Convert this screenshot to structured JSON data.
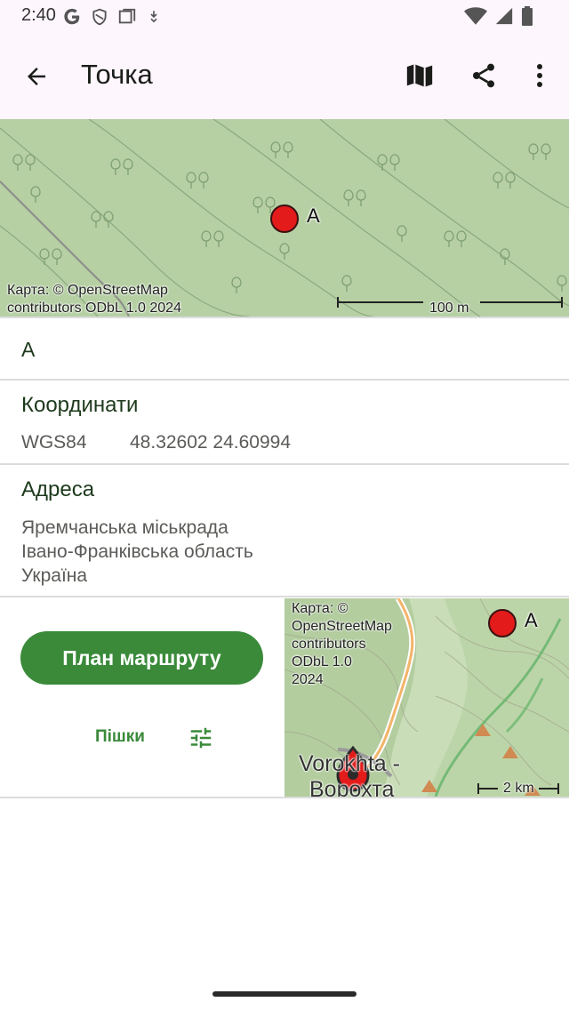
{
  "status": {
    "time": "2:40"
  },
  "appbar": {
    "title": "Точка"
  },
  "map_top": {
    "attribution_line1": "Карта: © OpenStreetMap",
    "attribution_line2": "contributors ODbL 1.0 2024",
    "scale": "100 m",
    "marker_label": "A"
  },
  "point": {
    "name": "A"
  },
  "coordinates": {
    "title": "Координати",
    "system": "WGS84",
    "value": "48.32602  24.60994"
  },
  "address": {
    "title": "Адреса",
    "lines": [
      "Яремчанська міськрада",
      "Івано-Франківська область",
      "Україна"
    ]
  },
  "route": {
    "button_label": "План маршруту",
    "mode": "Пішки"
  },
  "map_mini": {
    "attribution": [
      "Карта: ©",
      "OpenStreetMap",
      "contributors",
      "ODbL 1.0",
      "2024"
    ],
    "marker_label": "A",
    "place_label_1": "Vorokhta -",
    "place_label_2": "Ворохта",
    "scale": "2 km"
  },
  "colors": {
    "accent": "#3a8a3a",
    "marker": "#e31b1b",
    "appbar_bg": "#fdf6fc",
    "forest": "#b6d0a4"
  }
}
